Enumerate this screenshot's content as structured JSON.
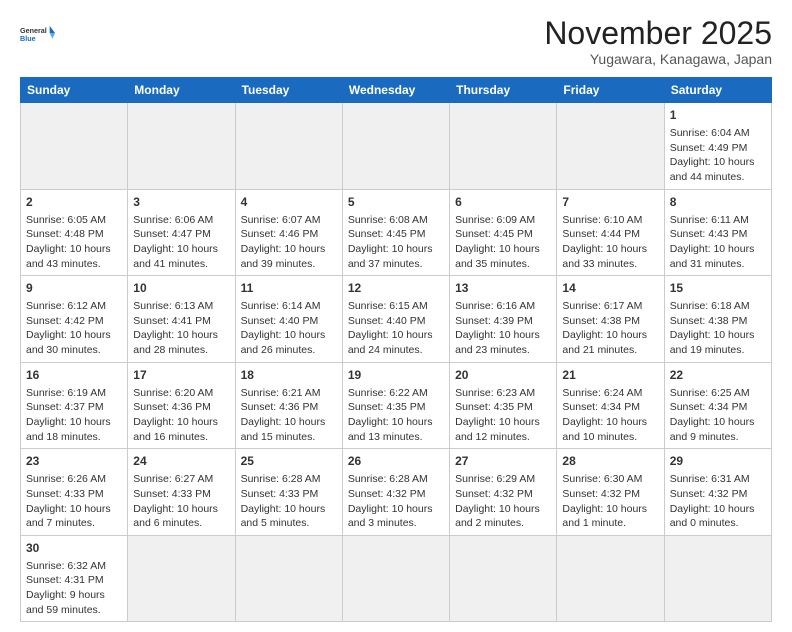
{
  "header": {
    "logo_general": "General",
    "logo_blue": "Blue",
    "title": "November 2025",
    "subtitle": "Yugawara, Kanagawa, Japan"
  },
  "days_of_week": [
    "Sunday",
    "Monday",
    "Tuesday",
    "Wednesday",
    "Thursday",
    "Friday",
    "Saturday"
  ],
  "weeks": [
    [
      {
        "day": "",
        "empty": true
      },
      {
        "day": "",
        "empty": true
      },
      {
        "day": "",
        "empty": true
      },
      {
        "day": "",
        "empty": true
      },
      {
        "day": "",
        "empty": true
      },
      {
        "day": "",
        "empty": true
      },
      {
        "day": "1",
        "sunrise": "6:04 AM",
        "sunset": "4:49 PM",
        "daylight": "10 hours and 44 minutes."
      }
    ],
    [
      {
        "day": "2",
        "sunrise": "6:05 AM",
        "sunset": "4:48 PM",
        "daylight": "10 hours and 43 minutes."
      },
      {
        "day": "3",
        "sunrise": "6:06 AM",
        "sunset": "4:47 PM",
        "daylight": "10 hours and 41 minutes."
      },
      {
        "day": "4",
        "sunrise": "6:07 AM",
        "sunset": "4:46 PM",
        "daylight": "10 hours and 39 minutes."
      },
      {
        "day": "5",
        "sunrise": "6:08 AM",
        "sunset": "4:45 PM",
        "daylight": "10 hours and 37 minutes."
      },
      {
        "day": "6",
        "sunrise": "6:09 AM",
        "sunset": "4:45 PM",
        "daylight": "10 hours and 35 minutes."
      },
      {
        "day": "7",
        "sunrise": "6:10 AM",
        "sunset": "4:44 PM",
        "daylight": "10 hours and 33 minutes."
      },
      {
        "day": "8",
        "sunrise": "6:11 AM",
        "sunset": "4:43 PM",
        "daylight": "10 hours and 31 minutes."
      }
    ],
    [
      {
        "day": "9",
        "sunrise": "6:12 AM",
        "sunset": "4:42 PM",
        "daylight": "10 hours and 30 minutes."
      },
      {
        "day": "10",
        "sunrise": "6:13 AM",
        "sunset": "4:41 PM",
        "daylight": "10 hours and 28 minutes."
      },
      {
        "day": "11",
        "sunrise": "6:14 AM",
        "sunset": "4:40 PM",
        "daylight": "10 hours and 26 minutes."
      },
      {
        "day": "12",
        "sunrise": "6:15 AM",
        "sunset": "4:40 PM",
        "daylight": "10 hours and 24 minutes."
      },
      {
        "day": "13",
        "sunrise": "6:16 AM",
        "sunset": "4:39 PM",
        "daylight": "10 hours and 23 minutes."
      },
      {
        "day": "14",
        "sunrise": "6:17 AM",
        "sunset": "4:38 PM",
        "daylight": "10 hours and 21 minutes."
      },
      {
        "day": "15",
        "sunrise": "6:18 AM",
        "sunset": "4:38 PM",
        "daylight": "10 hours and 19 minutes."
      }
    ],
    [
      {
        "day": "16",
        "sunrise": "6:19 AM",
        "sunset": "4:37 PM",
        "daylight": "10 hours and 18 minutes."
      },
      {
        "day": "17",
        "sunrise": "6:20 AM",
        "sunset": "4:36 PM",
        "daylight": "10 hours and 16 minutes."
      },
      {
        "day": "18",
        "sunrise": "6:21 AM",
        "sunset": "4:36 PM",
        "daylight": "10 hours and 15 minutes."
      },
      {
        "day": "19",
        "sunrise": "6:22 AM",
        "sunset": "4:35 PM",
        "daylight": "10 hours and 13 minutes."
      },
      {
        "day": "20",
        "sunrise": "6:23 AM",
        "sunset": "4:35 PM",
        "daylight": "10 hours and 12 minutes."
      },
      {
        "day": "21",
        "sunrise": "6:24 AM",
        "sunset": "4:34 PM",
        "daylight": "10 hours and 10 minutes."
      },
      {
        "day": "22",
        "sunrise": "6:25 AM",
        "sunset": "4:34 PM",
        "daylight": "10 hours and 9 minutes."
      }
    ],
    [
      {
        "day": "23",
        "sunrise": "6:26 AM",
        "sunset": "4:33 PM",
        "daylight": "10 hours and 7 minutes."
      },
      {
        "day": "24",
        "sunrise": "6:27 AM",
        "sunset": "4:33 PM",
        "daylight": "10 hours and 6 minutes."
      },
      {
        "day": "25",
        "sunrise": "6:28 AM",
        "sunset": "4:33 PM",
        "daylight": "10 hours and 5 minutes."
      },
      {
        "day": "26",
        "sunrise": "6:28 AM",
        "sunset": "4:32 PM",
        "daylight": "10 hours and 3 minutes."
      },
      {
        "day": "27",
        "sunrise": "6:29 AM",
        "sunset": "4:32 PM",
        "daylight": "10 hours and 2 minutes."
      },
      {
        "day": "28",
        "sunrise": "6:30 AM",
        "sunset": "4:32 PM",
        "daylight": "10 hours and 1 minute."
      },
      {
        "day": "29",
        "sunrise": "6:31 AM",
        "sunset": "4:32 PM",
        "daylight": "10 hours and 0 minutes."
      }
    ],
    [
      {
        "day": "30",
        "sunrise": "6:32 AM",
        "sunset": "4:31 PM",
        "daylight": "9 hours and 59 minutes."
      },
      {
        "day": "",
        "empty": true
      },
      {
        "day": "",
        "empty": true
      },
      {
        "day": "",
        "empty": true
      },
      {
        "day": "",
        "empty": true
      },
      {
        "day": "",
        "empty": true
      },
      {
        "day": "",
        "empty": true
      }
    ]
  ]
}
